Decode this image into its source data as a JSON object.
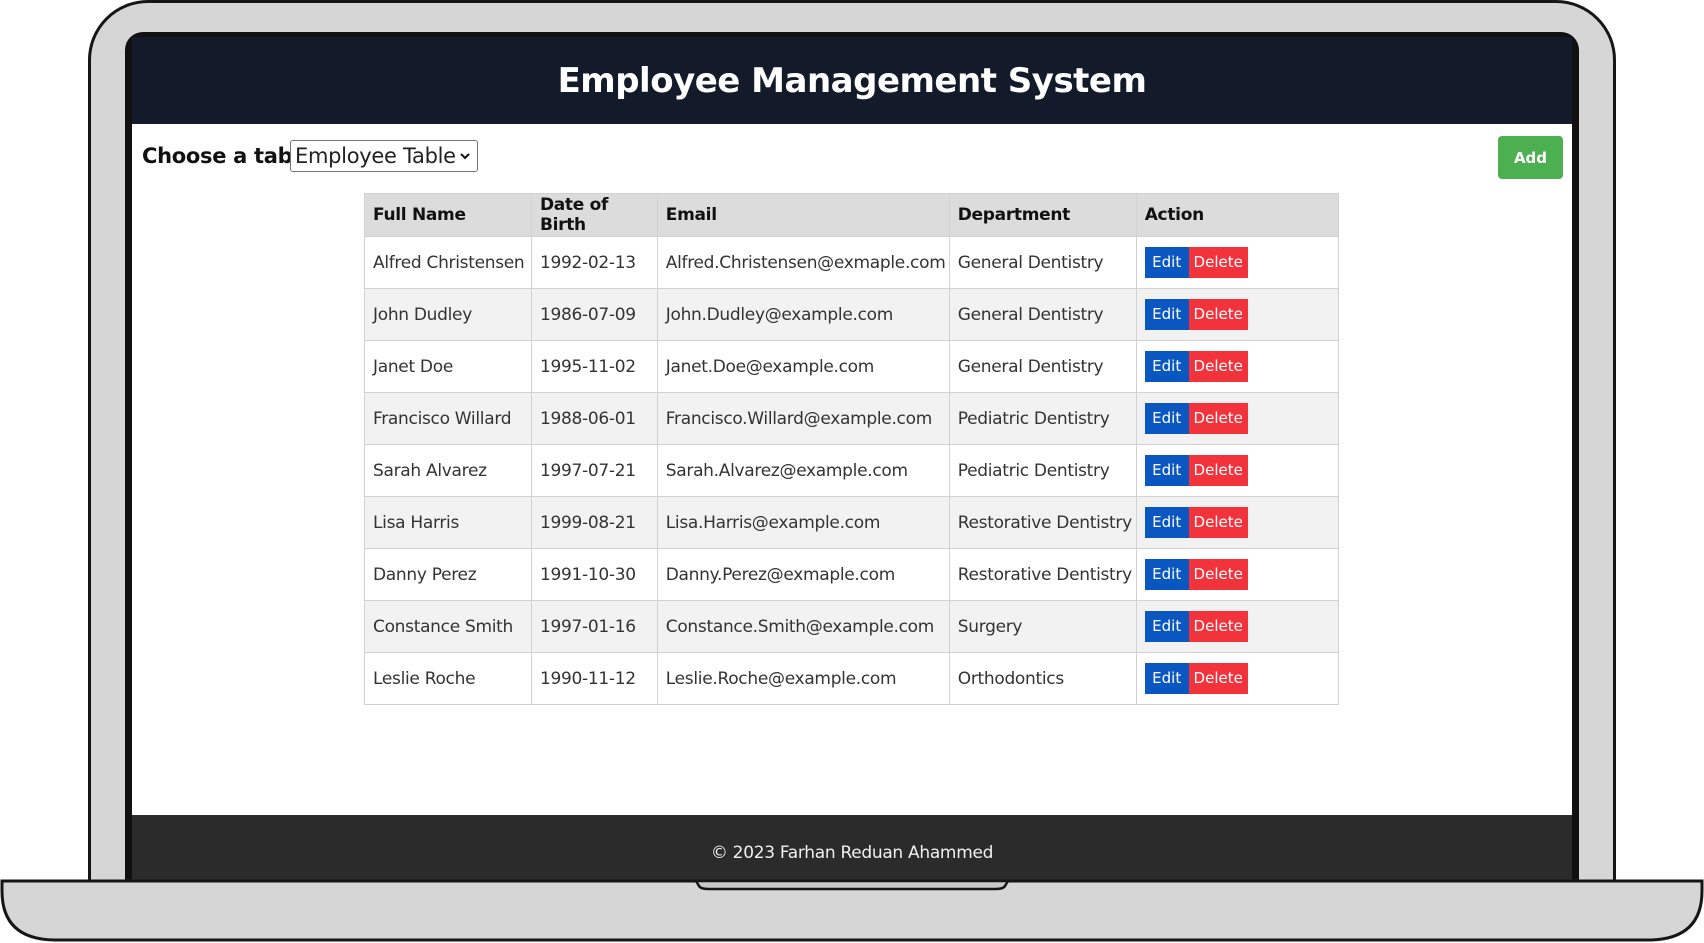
{
  "header": {
    "title": "Employee Management System"
  },
  "toolbar": {
    "choose_label": "Choose a table:",
    "selected_table": "Employee Table",
    "add_label": "Add"
  },
  "table": {
    "columns": [
      "Full Name",
      "Date of Birth",
      "Email",
      "Department",
      "Action"
    ],
    "edit_label": "Edit",
    "delete_label": "Delete",
    "rows": [
      [
        "Alfred Christensen",
        "1992-02-13",
        "Alfred.Christensen@exmaple.com",
        "General Dentistry"
      ],
      [
        "John Dudley",
        "1986-07-09",
        "John.Dudley@example.com",
        "General Dentistry"
      ],
      [
        "Janet Doe",
        "1995-11-02",
        "Janet.Doe@example.com",
        "General Dentistry"
      ],
      [
        "Francisco Willard",
        "1988-06-01",
        "Francisco.Willard@example.com",
        "Pediatric Dentistry"
      ],
      [
        "Sarah Alvarez",
        "1997-07-21",
        "Sarah.Alvarez@example.com",
        "Pediatric Dentistry"
      ],
      [
        "Lisa Harris",
        "1999-08-21",
        "Lisa.Harris@example.com",
        "Restorative Dentistry"
      ],
      [
        "Danny Perez",
        "1991-10-30",
        "Danny.Perez@exmaple.com",
        "Restorative Dentistry"
      ],
      [
        "Constance Smith",
        "1997-01-16",
        "Constance.Smith@example.com",
        "Surgery"
      ],
      [
        "Leslie Roche",
        "1990-11-12",
        "Leslie.Roche@example.com",
        "Orthodontics"
      ]
    ]
  },
  "footer": {
    "text": "© 2023 Farhan Reduan Ahammed"
  },
  "colors": {
    "header_bg": "#131a29",
    "footer_bg": "#2b2b2b",
    "add_green": "#4caf50",
    "edit_blue": "#0a57c2",
    "delete_red": "#f2333c",
    "table_header_bg": "#dcdcdc",
    "row_alt_bg": "#f2f2f2"
  },
  "icons": {
    "select": "chevron-down-icon"
  }
}
